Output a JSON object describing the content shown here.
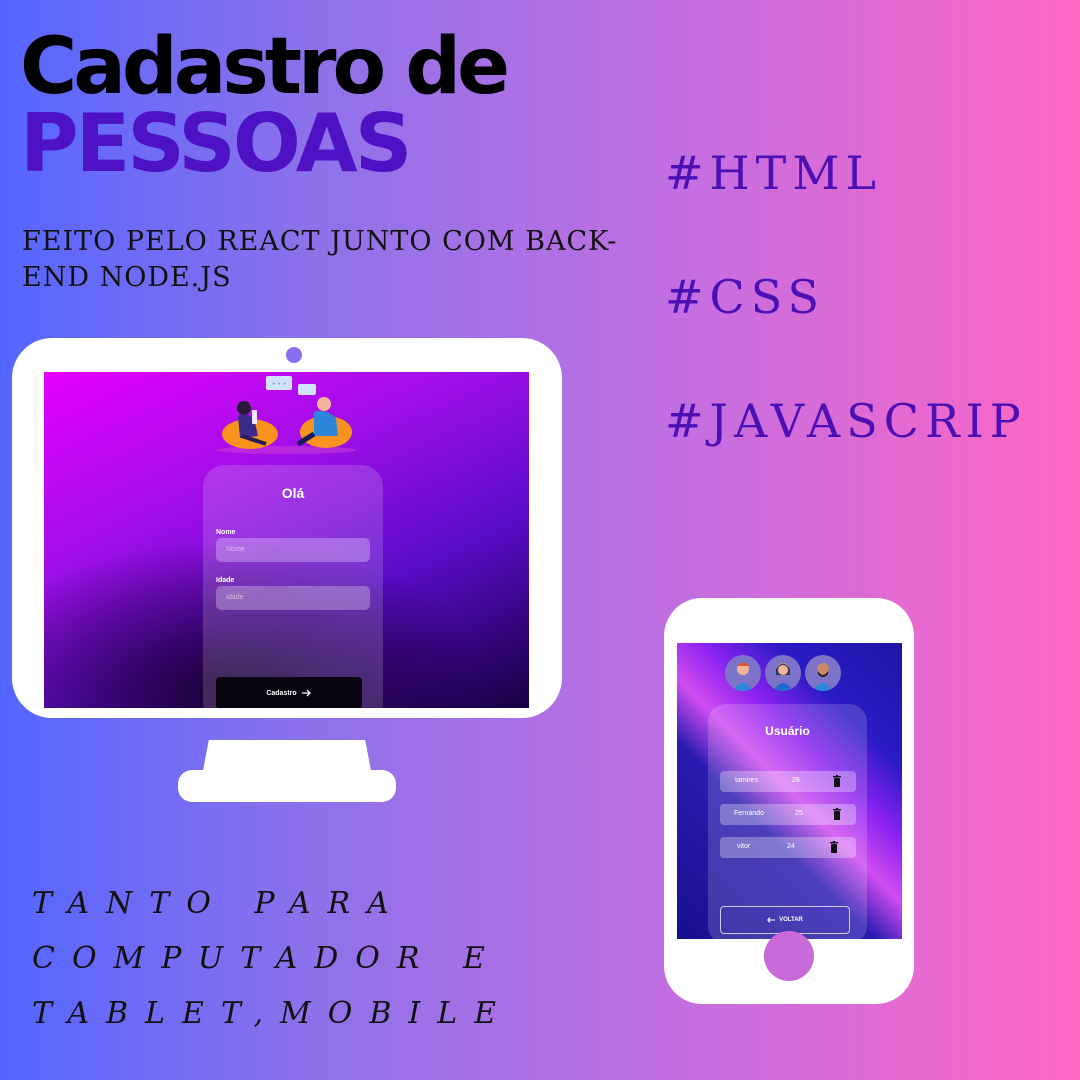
{
  "heading": {
    "line1": "Cadastro de",
    "line2": "PESSOAS"
  },
  "subtitle": "FEITO PELO REACT JUNTO COM BACK-END NODE.JS",
  "tags": [
    "#HTML",
    "#CSS",
    "#JAVASCRIP"
  ],
  "tagline": "TANTO PARA COMPUTADOR E TABLET,MOBILE",
  "desktop_app": {
    "form_title": "Olá",
    "fields": [
      {
        "label": "Nome",
        "placeholder": "Nome"
      },
      {
        "label": "Idade",
        "placeholder": "Idade"
      }
    ],
    "submit_label": "Cadastro",
    "submit_icon": "arrow-right-icon",
    "illustration": "two-people-chatting-illustration"
  },
  "mobile_app": {
    "title": "Usuário",
    "users": [
      {
        "name": "tamires",
        "age": "28"
      },
      {
        "name": "Fernando",
        "age": "25"
      },
      {
        "name": "vitor",
        "age": "24"
      }
    ],
    "delete_icon": "trash-icon",
    "back_label": "VOLTAR",
    "back_icon": "arrow-left-icon"
  },
  "colors": {
    "bg_left": "#5566ff",
    "bg_right": "#ff66c4",
    "accent_purple": "#4c12c4",
    "tag_color": "#4c0fb3"
  }
}
